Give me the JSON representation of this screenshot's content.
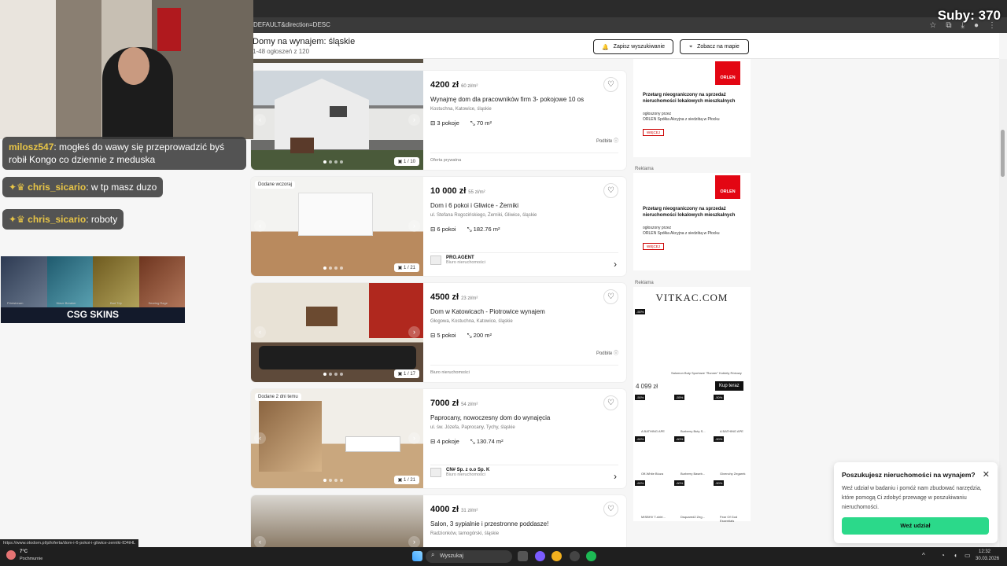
{
  "browser": {
    "url_fragment": "DEFAULT&direction=DESC"
  },
  "overlay": {
    "subs_label": "Suby: 370"
  },
  "header": {
    "title": "Domy na wynajem: śląskie",
    "subtitle": "1-48 ogłoszeń z 120",
    "save_search": "Zapisz wyszukiwanie",
    "see_map": "Zobacz na mapie"
  },
  "listings": [
    {
      "price": "4200 zł",
      "ppm": "60 zł/m²",
      "title": "Wynajmę dom dla pracowników firm 3- pokojowe 10 os",
      "location": "Kostuchna, Katowice, śląskie",
      "rooms": "3 pokoje",
      "area": "70 m²",
      "promo": "Podbite",
      "footer": "Oferta prywatna",
      "photo_count": "1 / 10",
      "badge": ""
    },
    {
      "price": "10 000 zł",
      "ppm": "55 zł/m²",
      "title": "Dom i 6 pokoi i Gliwice - Żerniki",
      "location": "ul. Stefana Rogozińskiego, Żerniki, Gliwice, śląskie",
      "rooms": "6 pokoi",
      "area": "182.76 m²",
      "agent_name": "PRO.AGENT",
      "agent_type": "Biuro nieruchomości",
      "photo_count": "1 / 21",
      "badge": "Dodane wczoraj"
    },
    {
      "price": "4500 zł",
      "ppm": "23 zł/m²",
      "title": "Dom w Katowicach - Piotrowice wynajem",
      "location": "Głogowa, Kostuchna, Katowice, śląskie",
      "rooms": "5 pokoi",
      "area": "200 m²",
      "promo": "Podbite",
      "footer": "Biuro nieruchomości",
      "photo_count": "1 / 17",
      "badge": ""
    },
    {
      "price": "7000 zł",
      "ppm": "54 zł/m²",
      "title": "Paprocany, nowoczesny dom do wynajęcia",
      "location": "ul. św. Józefa, Paprocany, Tychy, śląskie",
      "rooms": "4 pokoje",
      "area": "130.74 m²",
      "agent_name": "CN# Sp. z o.o Sp. K",
      "agent_type": "Biuro nieruchomości",
      "photo_count": "1 / 21",
      "badge": "Dodane 2 dni temu"
    },
    {
      "price": "4000 zł",
      "ppm": "31 zł/m²",
      "title": "Salon, 3 sypialnie i przestronne poddasze!",
      "location": "Radzionków, tarnogórski, śląskie",
      "rooms": "",
      "area": "",
      "photo_count": "",
      "badge": ""
    }
  ],
  "ads": {
    "label": "Reklama",
    "orlen": {
      "logo": "ORLEN",
      "headline": "Przetarg nieograniczony na sprzedaż nieruchomości lokalowych mieszkalnych",
      "body1": "ogłoszony przez",
      "body2": "ORLEN Spółka Akcyjna z siedzibą w Płocku",
      "button": "WIĘCEJ"
    },
    "vitkac": {
      "logo": "VITKAC.COM",
      "product": "Salomon Buty Sportowe \"Runner\" Kobiety Różowy",
      "price": "4 099 zł",
      "buy": "Kup teraz",
      "disc": "-50%",
      "disc2": "-55%",
      "disc3": "-60%",
      "items": [
        "A BATHING APE",
        "Burberry Buty S...",
        "A BATHING APE",
        "Off-White Bluza",
        "Burberry Baseb...",
        "Givenchy Zegarek",
        "MISBHV T-shirt...",
        "Dsquared2 Zeg...",
        "Fear Of God Essentials"
      ]
    }
  },
  "popup": {
    "title": "Poszukujesz nieruchomości na wynajem?",
    "body": "Weź udział w badaniu i pomóż nam zbudować narzędzia, które pomogą Ci zdobyć przewagę w poszukiwaniu nieruchomości.",
    "button": "Weź udział"
  },
  "chat": [
    {
      "user": "milosz547",
      "text": ": mogłeś do wawy się przeprowadzić byś robił Kongo co dziennie z meduska"
    },
    {
      "user": "chris_sicario",
      "text": ": w tp masz duzo"
    },
    {
      "user": "chris_sicario",
      "text": ": roboty"
    }
  ],
  "csgo": {
    "brand": "CSG SKINS",
    "items": [
      "Printstream",
      "Wave Breaker",
      "Bad Trip",
      "Searing Rage"
    ]
  },
  "status_link": "https://www.otodom.pl/pl/oferta/dom-i-6-pokoi-i-gliwice-zerniki-ID4iHL",
  "taskbar": {
    "temp": "7°C",
    "weather": "Pochmurnie",
    "search": "Wyszukaj",
    "time": "12:32",
    "date": "30.03.2026"
  },
  "colors": {
    "accent": "#2bd98a",
    "orlen": "#e30613"
  }
}
